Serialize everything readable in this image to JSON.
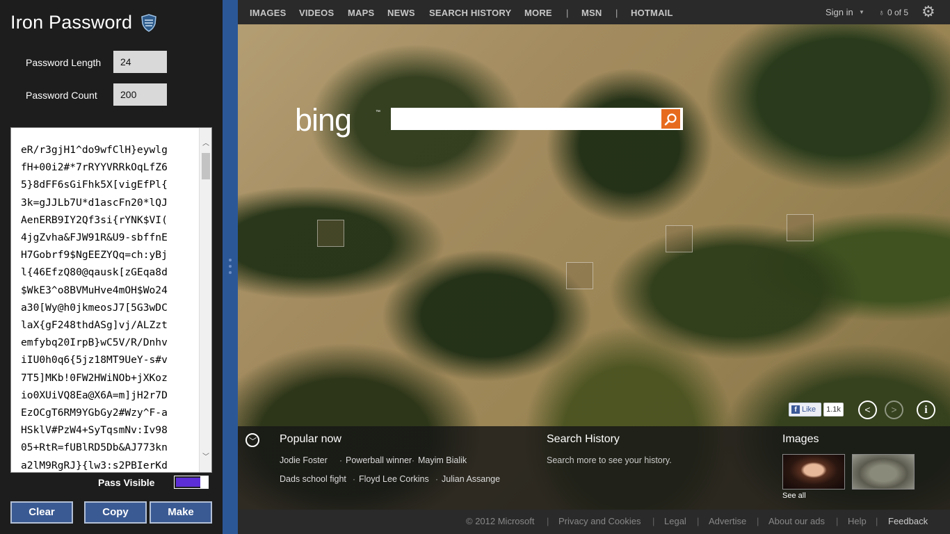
{
  "app": {
    "title": "Iron Password",
    "password_length_label": "Password Length",
    "password_length_value": "24",
    "password_count_label": "Password Count",
    "password_count_value": "200",
    "password_text": "eR/r3gjH1^do9wfClH}eywlg\nfH+00i2#*7rRYYVRRkOqLfZ6\n5}8dFF6sGiFhk5X[vigEfPl{\n3k=gJJLb7U*d1ascFn20*lQJ\nAenERB9IY2Qf3si{rYNK$VI(\n4jgZvha&FJW91R&U9-sbffnE\nH7Gobrf9$NgEEZYQq=ch:yBj\nl{46EfzQ80@qausk[zGEqa8d\n$WkE3^o8BVMuHve4mOH$Wo24\na30[Wy@h0jkmeosJ7[5G3wDC\nlaX{gF248thdASg]vj/ALZzt\nemfybq20IrpB}wC5V/R/Dnhv\niIU0h0q6{5jz18MT9UeY-s#v\n7T5]MKb!0FW2HWiNOb+jXKoz\nio0XUiVQ8Ea@X6A=m]jH2r7D\nEzOCgT6RM9YGbGy2#Wzy^F-a\nHSklV#PzW4+SyTqsmNv:Iv98\n05+RtR=fUBlRD5Db&AJ773kn\na2lM9RgRJ}{lw3:s2PBIerKd",
    "pass_visible_label": "Pass Visible",
    "pass_visible_on": true,
    "buttons": {
      "clear": "Clear",
      "copy": "Copy",
      "make": "Make"
    },
    "toggle_color": "#5c2ed6",
    "button_color": "#3a5a93"
  },
  "bing": {
    "nav": [
      "IMAGES",
      "VIDEOS",
      "MAPS",
      "NEWS",
      "SEARCH HISTORY",
      "MORE",
      "|",
      "MSN",
      "|",
      "HOTMAIL"
    ],
    "sign_in": "Sign in",
    "rewards": "0 of 5",
    "logo": "bing",
    "logo_tm": "™",
    "search_value": "",
    "fb_like": "Like",
    "fb_count": "1.1k",
    "popular_title": "Popular now",
    "popular_row1": [
      "Jodie Foster",
      "Powerball winner",
      "Mayim Bialik"
    ],
    "popular_row2": [
      "Dads school fight",
      "Floyd Lee Corkins",
      "Julian Assange"
    ],
    "history_title": "Search History",
    "history_text": "Search more to see your history.",
    "images_title": "Images",
    "see_all": "See all",
    "footer": [
      "© 2012 Microsoft",
      "Privacy and Cookies",
      "Legal",
      "Advertise",
      "About our ads",
      "Help",
      "Feedback"
    ],
    "accent_color": "#e76b1e"
  }
}
